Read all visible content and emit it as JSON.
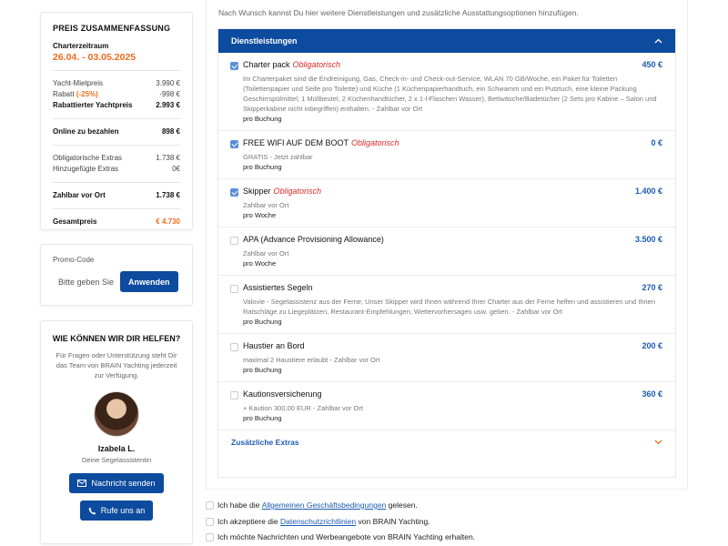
{
  "summary": {
    "title": "PREIS ZUSAMMENFASSUNG",
    "period_label": "Charterzeitraum",
    "period": "26.04. - 03.05.2025",
    "rows1": [
      {
        "label": "Yacht-Mietpreis",
        "value": "3.990 €"
      },
      {
        "label": "Rabatt ",
        "extra": "(-25%)",
        "value": "-998 €"
      },
      {
        "label": "Rabattierter Yachtpreis",
        "value": "2.993 €"
      }
    ],
    "online_label": "Online zu bezahlen",
    "online_value": "898 €",
    "rows2": [
      {
        "label": "Obligatorische Extras",
        "value": "1.738 €"
      },
      {
        "label": "Hinzugefügte Extras",
        "value": "0€"
      }
    ],
    "onsite_label": "Zahlbar vor Ort",
    "onsite_value": "1.738 €",
    "total_label": "Gesamtpreis",
    "total_value": "€ 4.730"
  },
  "promo": {
    "label": "Promo-Code",
    "placeholder": "Bitte geben Sie",
    "button": "Anwenden"
  },
  "help": {
    "title": "WIE KÖNNEN WIR DIR HELFEN?",
    "text": "Für Fragen oder Unterstützung steht Dir das Team von BRAIN Yachting jederzeit zur Verfügung.",
    "name": "Izabela L.",
    "role": "Deine Segelassistentin",
    "message_button": "Nachricht senden",
    "call_button": "Rufe uns an"
  },
  "intro": "Nach Wunsch kannst Du hier weitere Dienstleistungen und zusätzliche Ausstattungsoptionen hinzufügen.",
  "services_header": "Dienstleistungen",
  "services": [
    {
      "name": "Charter pack",
      "required": "Obligatorisch",
      "price": "450 €",
      "checked": true,
      "desc": "Im Charterpaket sind die Endreinigung, Gas, Check-in- und Check-out-Service, WLAN 70 GB/Woche, ein Paket für Toiletten (Toilettenpapier und Seife pro Toilette) und Küche (1 Küchenpapierhandtuch, ein Schwamm und ein Putztuch, eine kleine Packung Geschirrspülmittel, 1 Müllbeutel, 2 Küchenhandtücher, 2 x 1-l-Flaschen Wasser), Bettwäsche/Badetücher (2 Sets pro Kabine – Salon und Skipperkabine nicht inbegriffen) enthalten. - Zahlbar vor Ort",
      "unit": "pro Buchung"
    },
    {
      "name": "FREE WIFI AUF DEM BOOT",
      "required": "Obligatorisch",
      "price": "0 €",
      "checked": true,
      "desc": "GRATIS - Jetzt zahlbar",
      "unit": "pro Buchung"
    },
    {
      "name": "Skipper",
      "required": "Obligatorisch",
      "price": "1.400 €",
      "checked": true,
      "desc": "Zahlbar vor Ort",
      "unit": "pro Woche"
    },
    {
      "name": "APA (Advance Provisioning Allowance)",
      "required": "",
      "price": "3.500 €",
      "checked": false,
      "desc": "Zahlbar vor Ort",
      "unit": "pro Woche"
    },
    {
      "name": "Assistiertes Segeln",
      "required": "",
      "price": "270 €",
      "checked": false,
      "desc": "Valovie - Segelassistenz aus der Ferne; Unser Skipper wird Ihnen während Ihrer Charter aus der Ferne helfen und assistieren und Ihnen Ratschläge zu Liegeplätzen, Restaurant-Empfehlungen, Wettervorhersagen usw. geben. - Zahlbar vor Ort",
      "unit": "pro Buchung"
    },
    {
      "name": "Haustier an Bord",
      "required": "",
      "price": "200 €",
      "checked": false,
      "desc": "maximal 2 Haustiere erlaubt - Zahlbar vor Ort",
      "unit": "pro Buchung"
    },
    {
      "name": "Kautionsversicherung",
      "required": "",
      "price": "360 €",
      "checked": false,
      "desc": "+ Kaution 300,00 EUR - Zahlbar vor Ort",
      "unit": "pro Buchung"
    }
  ],
  "extras_label": "Zusätzliche Extras",
  "terms": [
    {
      "pre": "Ich habe die ",
      "link": "Allgemeinen Geschäftsbedingungen",
      "post": " gelesen."
    },
    {
      "pre": "Ich akzeptiere die ",
      "link": "Datenschutzrichtlinien",
      "post": " von BRAIN Yachting."
    },
    {
      "pre": "Ich möchte Nachrichten und Werbeangebote von BRAIN Yachting erhalten.",
      "link": "",
      "post": ""
    }
  ],
  "colors": {
    "primary": "#0d4b9e",
    "accent": "#f26b1d",
    "required": "#d92b2b",
    "price": "#1c5bb0"
  },
  "icons": {
    "header": "chevron-up-icon",
    "extras": "chevron-down-icon",
    "message": "envelope-icon",
    "call": "phone-icon"
  }
}
